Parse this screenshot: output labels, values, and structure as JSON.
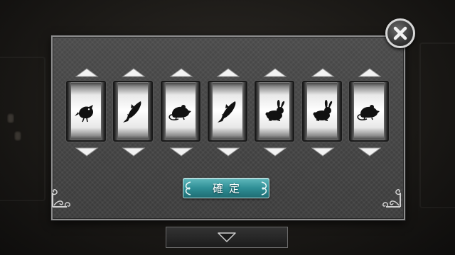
{
  "dialog": {
    "confirm_label": "確定",
    "close_icon": "close-x-icon"
  },
  "reels": [
    {
      "symbol": "bird"
    },
    {
      "symbol": "fish"
    },
    {
      "symbol": "rat"
    },
    {
      "symbol": "fish"
    },
    {
      "symbol": "rabbit"
    },
    {
      "symbol": "rabbit"
    },
    {
      "symbol": "rat"
    }
  ],
  "footer": {
    "icon": "chevron-down-icon"
  },
  "colors": {
    "confirm_button": "#2f8f96",
    "dialog_bg": "#424242",
    "reel_face": "#ffffff"
  }
}
